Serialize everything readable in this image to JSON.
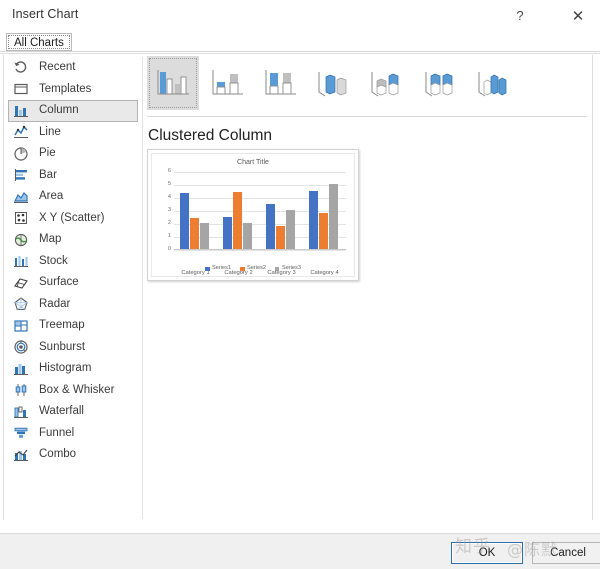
{
  "window": {
    "title": "Insert Chart",
    "help_label": "?",
    "close_label": "✕"
  },
  "tabs": [
    {
      "label": "All Charts",
      "selected": true
    }
  ],
  "sidebar": {
    "items": [
      {
        "label": "Recent",
        "icon": "recent-icon",
        "selected": false
      },
      {
        "label": "Templates",
        "icon": "templates-icon",
        "selected": false
      },
      {
        "label": "Column",
        "icon": "column-icon",
        "selected": true
      },
      {
        "label": "Line",
        "icon": "line-icon",
        "selected": false
      },
      {
        "label": "Pie",
        "icon": "pie-icon",
        "selected": false
      },
      {
        "label": "Bar",
        "icon": "bar-icon",
        "selected": false
      },
      {
        "label": "Area",
        "icon": "area-icon",
        "selected": false
      },
      {
        "label": "X Y (Scatter)",
        "icon": "scatter-icon",
        "selected": false
      },
      {
        "label": "Map",
        "icon": "map-icon",
        "selected": false
      },
      {
        "label": "Stock",
        "icon": "stock-icon",
        "selected": false
      },
      {
        "label": "Surface",
        "icon": "surface-icon",
        "selected": false
      },
      {
        "label": "Radar",
        "icon": "radar-icon",
        "selected": false
      },
      {
        "label": "Treemap",
        "icon": "treemap-icon",
        "selected": false
      },
      {
        "label": "Sunburst",
        "icon": "sunburst-icon",
        "selected": false
      },
      {
        "label": "Histogram",
        "icon": "histogram-icon",
        "selected": false
      },
      {
        "label": "Box & Whisker",
        "icon": "box-whisker-icon",
        "selected": false
      },
      {
        "label": "Waterfall",
        "icon": "waterfall-icon",
        "selected": false
      },
      {
        "label": "Funnel",
        "icon": "funnel-icon",
        "selected": false
      },
      {
        "label": "Combo",
        "icon": "combo-icon",
        "selected": false
      }
    ]
  },
  "gallery": {
    "thumbnails": [
      {
        "name": "clustered-column",
        "selected": true
      },
      {
        "name": "stacked-column",
        "selected": false
      },
      {
        "name": "100-percent-stacked-column",
        "selected": false
      },
      {
        "name": "3d-clustered-column",
        "selected": false
      },
      {
        "name": "3d-stacked-column",
        "selected": false
      },
      {
        "name": "3d-100-percent-stacked-column",
        "selected": false
      },
      {
        "name": "3d-column",
        "selected": false
      }
    ]
  },
  "preview": {
    "heading": "Clustered Column"
  },
  "footer": {
    "ok_label": "OK",
    "cancel_label": "Cancel"
  },
  "watermark": {
    "site": "知乎",
    "user": "@陈默"
  },
  "colors": {
    "series1": "#4472c4",
    "series2": "#ed7d31",
    "series3": "#a5a5a5",
    "accent_default_button": "#2f6fa8",
    "selection_gray": "#e9e9e9",
    "thumb_selected_gray": "#dcdcdc"
  },
  "chart_data": {
    "type": "bar",
    "title": "Chart Title",
    "xlabel": "",
    "ylabel": "",
    "ylim": [
      0,
      6
    ],
    "yticks": [
      0,
      1,
      2,
      3,
      4,
      5,
      6
    ],
    "grid": true,
    "legend_position": "bottom",
    "categories": [
      "Category 1",
      "Category 2",
      "Category 3",
      "Category 4"
    ],
    "series": [
      {
        "name": "Series1",
        "color": "#4472c4",
        "values": [
          4.3,
          2.5,
          3.5,
          4.5
        ]
      },
      {
        "name": "Series2",
        "color": "#ed7d31",
        "values": [
          2.4,
          4.4,
          1.8,
          2.8
        ]
      },
      {
        "name": "Series3",
        "color": "#a5a5a5",
        "values": [
          2.0,
          2.0,
          3.0,
          5.0
        ]
      }
    ]
  }
}
